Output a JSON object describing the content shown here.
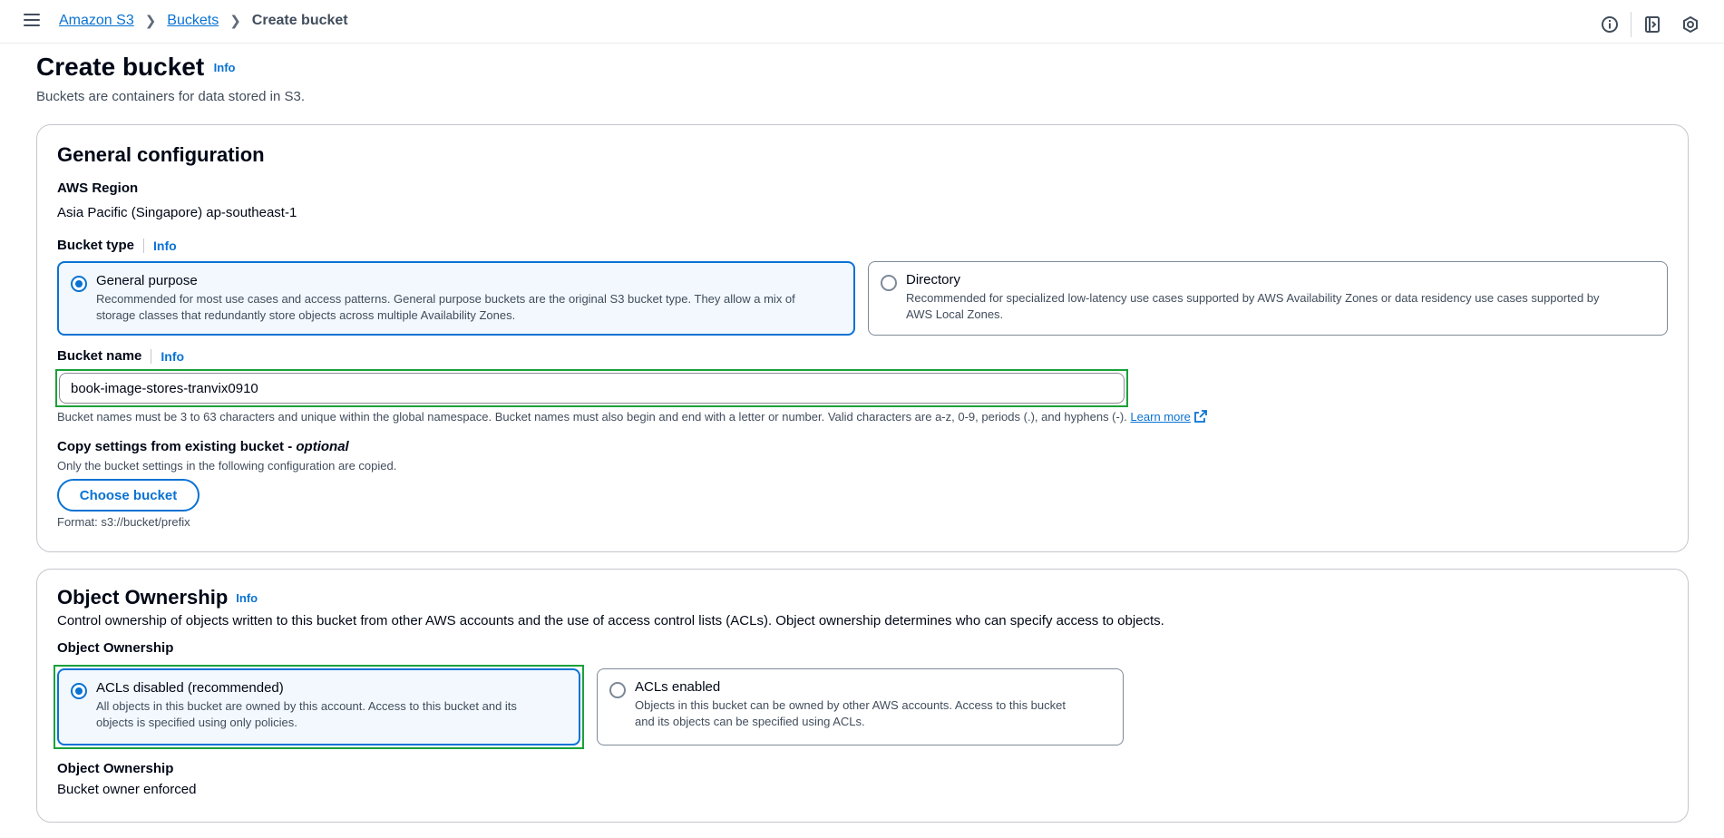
{
  "breadcrumb": {
    "items": [
      "Amazon S3",
      "Buckets"
    ],
    "current": "Create bucket"
  },
  "header": {
    "title": "Create bucket",
    "info": "Info",
    "description": "Buckets are containers for data stored in S3."
  },
  "general": {
    "title": "General configuration",
    "region_label": "AWS Region",
    "region_value": "Asia Pacific (Singapore) ap-southeast-1",
    "bucket_type_label": "Bucket type",
    "info": "Info",
    "types": [
      {
        "title": "General purpose",
        "desc1": "Recommended for most use cases and access patterns. General purpose buckets are the original S3 bucket type. They allow a mix of",
        "desc2": "storage classes that redundantly store objects across multiple Availability Zones.",
        "selected": true
      },
      {
        "title": "Directory",
        "desc1": "Recommended for specialized low-latency use cases supported by AWS Availability Zones or data residency use cases supported by",
        "desc2": "AWS Local Zones.",
        "selected": false
      }
    ],
    "bucket_name_label": "Bucket name",
    "bucket_name_value": "book-image-stores-tranvix0910",
    "bucket_name_hint": "Bucket names must be 3 to 63 characters and unique within the global namespace. Bucket names must also begin and end with a letter or number. Valid characters are a-z, 0-9, periods (.), and hyphens (-).",
    "learn_more": "Learn more",
    "copy_label": "Copy settings from existing bucket - ",
    "copy_optional": "optional",
    "copy_desc": "Only the bucket settings in the following configuration are copied.",
    "choose_bucket": "Choose bucket",
    "format": "Format: s3://bucket/prefix"
  },
  "ownership": {
    "title": "Object Ownership",
    "info": "Info",
    "description": "Control ownership of objects written to this bucket from other AWS accounts and the use of access control lists (ACLs). Object ownership determines who can specify access to objects.",
    "field_label": "Object Ownership",
    "options": [
      {
        "title": "ACLs disabled (recommended)",
        "desc1": "All objects in this bucket are owned by this account. Access to this bucket and its",
        "desc2": "objects is specified using only policies.",
        "selected": true
      },
      {
        "title": "ACLs enabled",
        "desc1": "Objects in this bucket can be owned by other AWS accounts. Access to this bucket",
        "desc2": "and its objects can be specified using ACLs.",
        "selected": false
      }
    ],
    "result_label": "Object Ownership",
    "result_value": "Bucket owner enforced"
  },
  "icons": {
    "menu": "hamburger-menu-icon",
    "info": "info-circle-icon",
    "notifications": "panel-icon",
    "settings": "hexagon-gear-icon",
    "external": "external-link-icon"
  },
  "colors": {
    "accent": "#0972d3",
    "highlight": "#1aa13a",
    "selected_bg": "#f2f8fd"
  }
}
